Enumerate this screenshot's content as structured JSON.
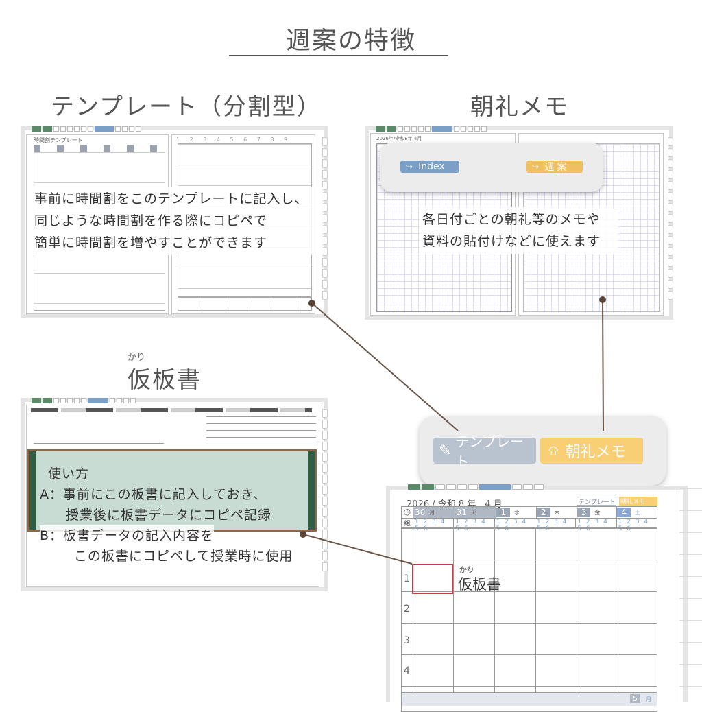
{
  "title": "週案の特徴",
  "sections": {
    "template": {
      "heading": "テンプレート（分割型）",
      "page_label": "時間割テンプレート",
      "desc_lines": [
        "事前に時間割をこのテンプレートに記入し、",
        "同じような時間割を作る際にコピペで",
        "簡単に時間割を増やすことができます"
      ]
    },
    "morning": {
      "heading": "朝礼メモ",
      "date_label": "2026年/令和8年 4月",
      "popup_index_label": "Index",
      "popup_weekly_label": "週 案",
      "desc_lines": [
        "各日付ごとの朝礼等のメモや",
        "資料の貼付けなどに使えます"
      ]
    },
    "board": {
      "ruby": "かり",
      "heading": "仮板書",
      "usage_title": "使い方",
      "usage_lines": [
        "A：事前にこの板書に記入しておき、",
        "授業後に板書データにコピペ記録",
        "B：板書データの記入内容を",
        "この板書にコピペして授業時に使用"
      ]
    }
  },
  "center_popup": {
    "template_button": "テンプレート",
    "morning_button": "朝礼メモ"
  },
  "calendar": {
    "month_label": "2026 / 令和 8 年　4 月",
    "template_link": "テンプレート",
    "morning_link": "朝礼メモ",
    "row_header": "組",
    "days": [
      {
        "num": "30",
        "dow": "月"
      },
      {
        "num": "31",
        "dow": "火"
      },
      {
        "num": "1",
        "dow": "水"
      },
      {
        "num": "2",
        "dow": "木"
      },
      {
        "num": "3",
        "dow": "金"
      },
      {
        "num": "4",
        "dow": "土"
      }
    ],
    "periods": "1 2 3 4 5 6",
    "rows": [
      "1",
      "2",
      "3",
      "4"
    ],
    "next_month_num": "5",
    "next_month_unit": "月",
    "cell_ruby": "かり",
    "cell_label": "仮板書"
  },
  "colors": {
    "template_button": "#b9c3cf",
    "morning_button": "#f8cf75",
    "index_pill": "#7aa0c8",
    "weekly_pill": "#f0c060",
    "board_surface": "#c9dcd4",
    "board_frame": "#2f5e45",
    "calendar_header": "#b0b8c4",
    "connector": "#6a5446"
  },
  "icons": [
    "pencil-note-icon",
    "bell-icon",
    "arrow-index-icon",
    "arrow-weekly-icon",
    "clock-icon"
  ]
}
